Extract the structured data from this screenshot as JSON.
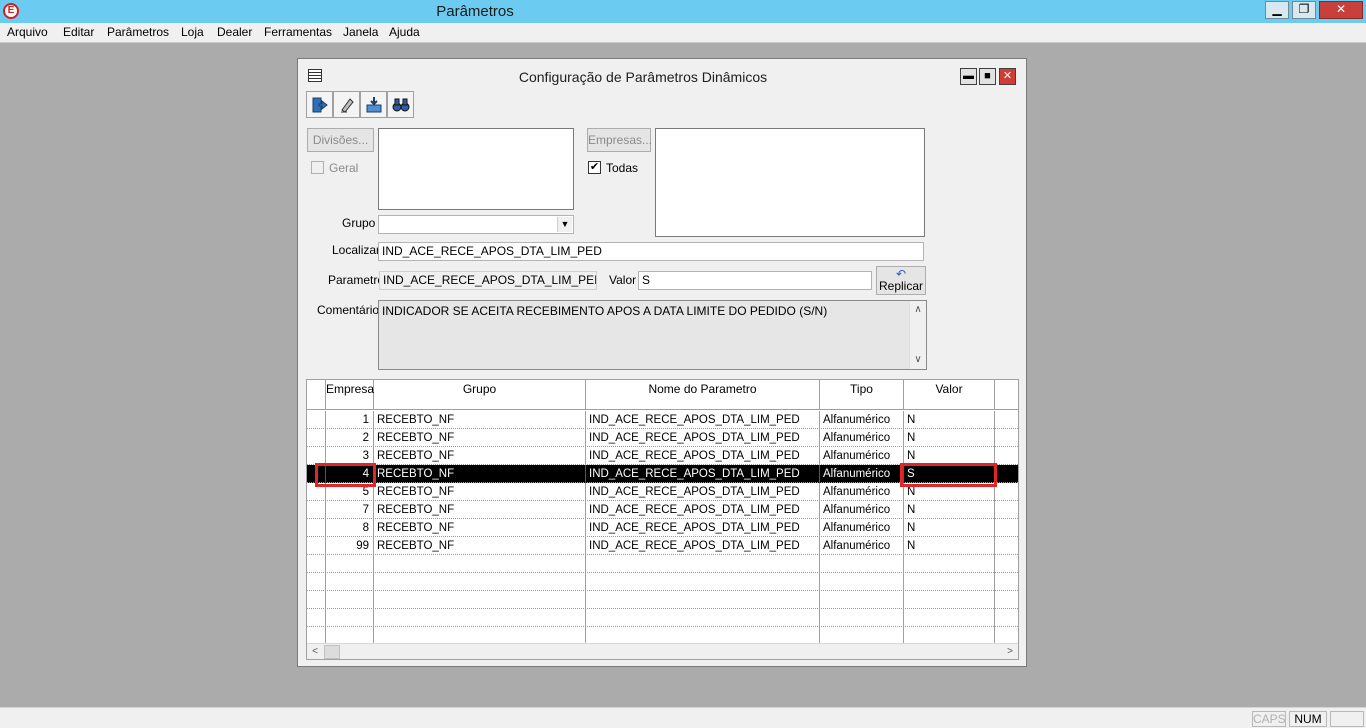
{
  "app": {
    "logo_text": "E",
    "title": "Parâmetros",
    "controls": {
      "minimize": "▁",
      "restore": "❐",
      "close": "✕"
    }
  },
  "menu": [
    {
      "label": "Arquivo"
    },
    {
      "label": "Editar"
    },
    {
      "label": "Parâmetros"
    },
    {
      "label": "Loja"
    },
    {
      "label": "Dealer"
    },
    {
      "label": "Ferramentas"
    },
    {
      "label": "Janela"
    },
    {
      "label": "Ajuda"
    }
  ],
  "window": {
    "title": "Configuração de Parâmetros Dinâmicos",
    "controls": {
      "minimize": "▬",
      "restore": "■",
      "close": "✕"
    },
    "toolbar": [
      "exit-icon",
      "eraser-icon",
      "save-icon",
      "binoculars-icon"
    ]
  },
  "form": {
    "divisoes_button": "Divisões...",
    "geral_label": "Geral",
    "geral_checked": false,
    "empresas_button": "Empresas...",
    "todas_label": "Todas",
    "todas_checked": true,
    "todas_mark": "✔",
    "grupo_label": "Grupo",
    "grupo_value": "",
    "localizar_label": "Localizar",
    "localizar_value": "IND_ACE_RECE_APOS_DTA_LIM_PED",
    "parametro_label": "Parametro",
    "parametro_value": "IND_ACE_RECE_APOS_DTA_LIM_PED",
    "valor_label": "Valor",
    "valor_value": "S",
    "replicar_button": "Replicar",
    "replicar_icon": "↶",
    "comentarios_label": "Comentários",
    "comentarios_value": "INDICADOR SE ACEITA RECEBIMENTO APOS A DATA LIMITE DO PEDIDO (S/N)"
  },
  "grid": {
    "columns": [
      "Empresa",
      "Grupo",
      "Nome do Parametro",
      "Tipo",
      "Valor"
    ],
    "rows": [
      {
        "empresa": "1",
        "grupo": "RECEBTO_NF",
        "nome": "IND_ACE_RECE_APOS_DTA_LIM_PED",
        "tipo": "Alfanumérico",
        "valor": "N"
      },
      {
        "empresa": "2",
        "grupo": "RECEBTO_NF",
        "nome": "IND_ACE_RECE_APOS_DTA_LIM_PED",
        "tipo": "Alfanumérico",
        "valor": "N"
      },
      {
        "empresa": "3",
        "grupo": "RECEBTO_NF",
        "nome": "IND_ACE_RECE_APOS_DTA_LIM_PED",
        "tipo": "Alfanumérico",
        "valor": "N"
      },
      {
        "empresa": "4",
        "grupo": "RECEBTO_NF",
        "nome": "IND_ACE_RECE_APOS_DTA_LIM_PED",
        "tipo": "Alfanumérico",
        "valor": "S"
      },
      {
        "empresa": "5",
        "grupo": "RECEBTO_NF",
        "nome": "IND_ACE_RECE_APOS_DTA_LIM_PED",
        "tipo": "Alfanumérico",
        "valor": "N"
      },
      {
        "empresa": "7",
        "grupo": "RECEBTO_NF",
        "nome": "IND_ACE_RECE_APOS_DTA_LIM_PED",
        "tipo": "Alfanumérico",
        "valor": "N"
      },
      {
        "empresa": "8",
        "grupo": "RECEBTO_NF",
        "nome": "IND_ACE_RECE_APOS_DTA_LIM_PED",
        "tipo": "Alfanumérico",
        "valor": "N"
      },
      {
        "empresa": "99",
        "grupo": "RECEBTO_NF",
        "nome": "IND_ACE_RECE_APOS_DTA_LIM_PED",
        "tipo": "Alfanumérico",
        "valor": "N"
      }
    ],
    "selected_row": 3,
    "empty_rows": 5
  },
  "status": {
    "caps": "CAPS",
    "num": "NUM"
  },
  "colors": {
    "title_bar": "#6bcbf0",
    "highlight_box": "#e0262b",
    "selection": "#000000"
  }
}
